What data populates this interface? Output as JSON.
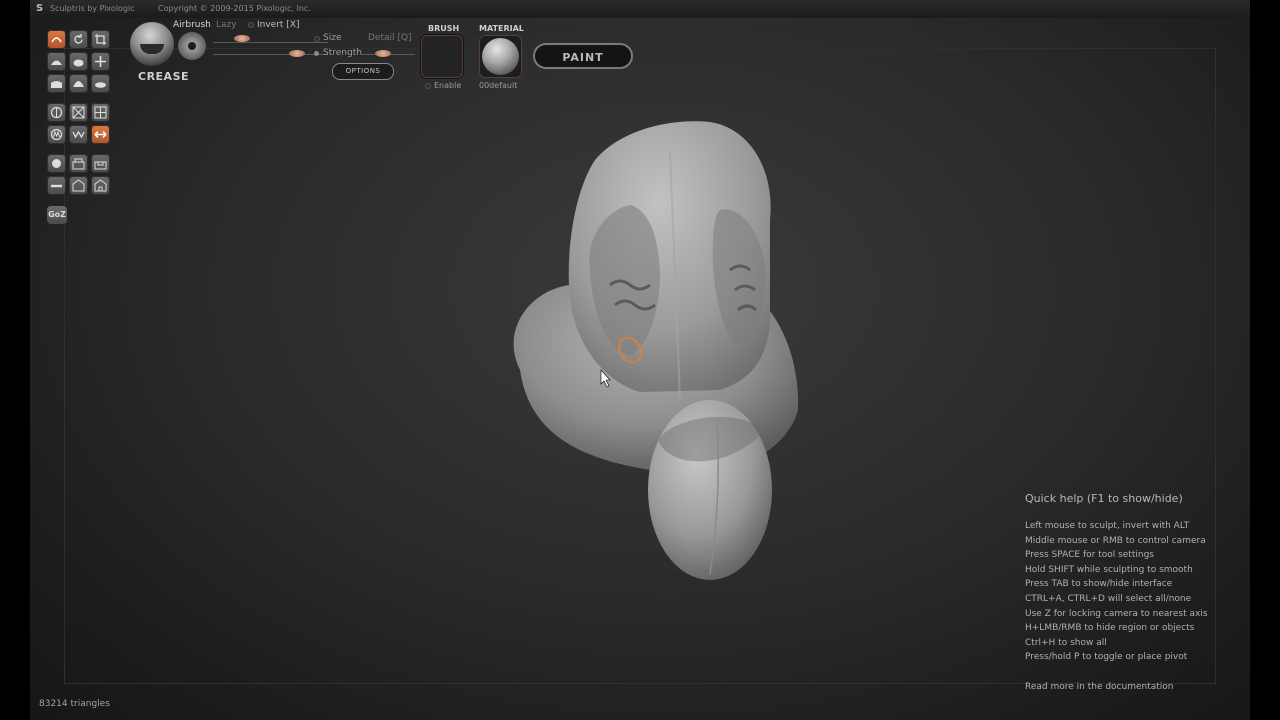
{
  "titlebar": {
    "app_title": "Sculptris by Pixologic",
    "copyright": "Copyright © 2009-2015 Pixologic, Inc."
  },
  "brush_panel": {
    "brush_name": "CREASE",
    "airbrush": "Airbrush",
    "lazy": "Lazy",
    "invert": "Invert [X]",
    "size": "Size",
    "strength": "Strength",
    "detail": "Detail [Q]",
    "options": "OPTIONS"
  },
  "brush_slot": {
    "header": "BRUSH",
    "enable": "Enable"
  },
  "material_slot": {
    "header": "MATERIAL",
    "name": "00default"
  },
  "paint_button": "PAINT",
  "goz": "GoZ",
  "help": {
    "title": "Quick help (F1 to show/hide)",
    "lines": [
      "Left mouse to sculpt, invert with ALT",
      "Middle mouse or RMB to control camera",
      "Press SPACE for tool settings",
      "Hold SHIFT while sculpting to smooth",
      "Press TAB to show/hide interface",
      "CTRL+A, CTRL+D will select all/none",
      "Use Z for locking camera to nearest axis",
      "H+LMB/RMB to hide region or objects",
      "Ctrl+H to show all",
      "Press/hold P to toggle or place pivot"
    ],
    "more": "Read more in the documentation"
  },
  "status": {
    "triangles": "83214 triangles"
  },
  "colors": {
    "accent": "#c8683a",
    "background": "#2c2c2c"
  }
}
